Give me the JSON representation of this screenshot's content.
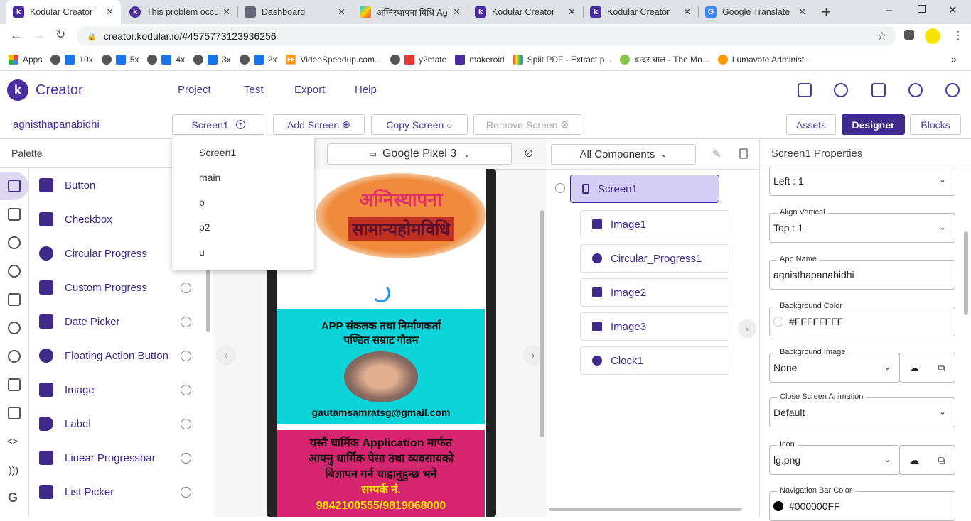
{
  "browser": {
    "tabs": [
      {
        "title": "Kodular Creator",
        "active": true
      },
      {
        "title": "This problem occu"
      },
      {
        "title": "Dashboard"
      },
      {
        "title": "अग्निस्थापना विधि Ag"
      },
      {
        "title": "Kodular Creator"
      },
      {
        "title": "Kodular Creator"
      },
      {
        "title": "Google Translate"
      }
    ],
    "new_tab": "+",
    "url": "creator.kodular.io/#4575773123936256",
    "bookmarks": [
      "Apps",
      "10x",
      "5x",
      "4x",
      "3x",
      "2x",
      "VideoSpeedup.com...",
      "y2mate",
      "makeroid",
      "Split PDF - Extract p...",
      "बन्दर चाल - The Mo...",
      "Lumavate Administ..."
    ],
    "more": "»"
  },
  "app": {
    "logo": "Creator",
    "menu": [
      "Project",
      "Test",
      "Export",
      "Help"
    ]
  },
  "toolbar": {
    "project": "agnisthapanabidhi",
    "screen": "Screen1",
    "add": "Add Screen",
    "copy": "Copy Screen",
    "remove": "Remove Screen",
    "assets": "Assets",
    "designer": "Designer",
    "blocks": "Blocks"
  },
  "screen_menu": [
    "Screen1",
    "main",
    "p",
    "p2",
    "u"
  ],
  "palette": {
    "title": "Palette",
    "items": [
      "Button",
      "Checkbox",
      "Circular Progress",
      "Custom Progress",
      "Date Picker",
      "Floating Action Button",
      "Image",
      "Label",
      "Linear Progressbar",
      "List Picker"
    ]
  },
  "viewer": {
    "device": "Google Pixel 3",
    "phone": {
      "banner1": "अग्निस्थापना",
      "banner2": "सामान्यहोमविधि",
      "credit1": "APP संकलक तथा निर्माणकर्ता",
      "credit2": "पण्डित सम्राट गौतम",
      "email": "gautamsamratsg@gmail.com",
      "ad1": "यस्तै धार्मिक  Application मार्फत",
      "ad2": "आफ्नु धार्मिक पेसा तथा व्यवसायको",
      "ad3": "बिज्ञापन गर्न चाहानुहुन्छ भने",
      "contact": "सम्पर्क नं.",
      "phone": "9842100555/9819068000"
    }
  },
  "components": {
    "filter": "All Components",
    "root": "Screen1",
    "children": [
      "Image1",
      "Circular_Progress1",
      "Image2",
      "Image3",
      "Clock1"
    ]
  },
  "properties": {
    "title": "Screen1 Properties",
    "fields": [
      {
        "label": "",
        "value": "Left : 1"
      },
      {
        "label": "Align Vertical",
        "value": "Top : 1"
      },
      {
        "label": "App Name",
        "value": "agnisthapanabidhi"
      },
      {
        "label": "Background Color",
        "value": "#FFFFFFFF"
      },
      {
        "label": "Background Image",
        "value": "None"
      },
      {
        "label": "Close Screen Animation",
        "value": "Default"
      },
      {
        "label": "Icon",
        "value": "lg.png"
      },
      {
        "label": "Navigation Bar Color",
        "value": "#000000FF"
      }
    ]
  }
}
